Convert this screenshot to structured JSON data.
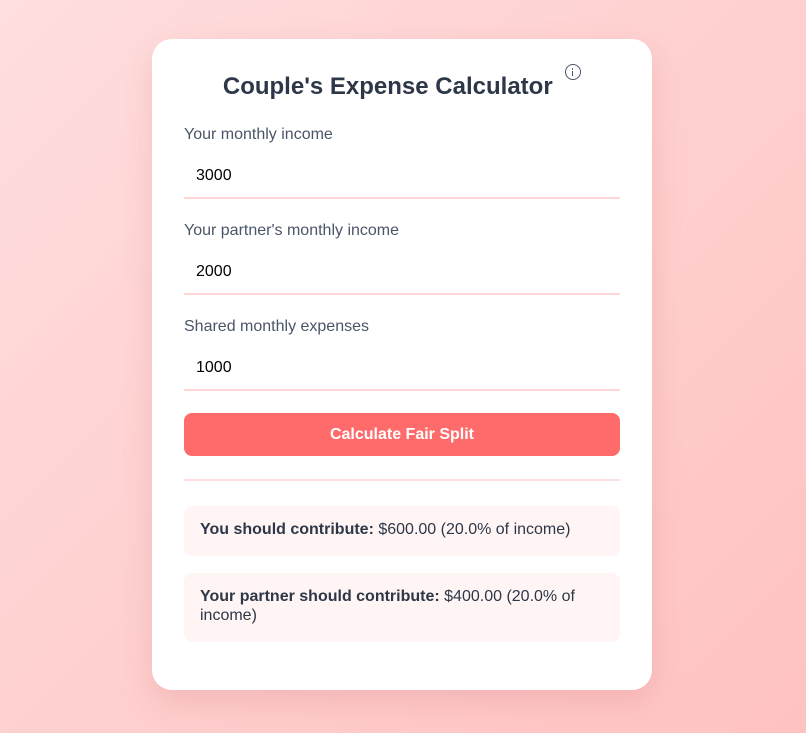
{
  "app": {
    "title": "Couple's Expense Calculator",
    "info_icon": "info-circle-icon"
  },
  "form": {
    "income": {
      "label": "Your monthly income",
      "value": "3000"
    },
    "partner_income": {
      "label": "Your partner's monthly income",
      "value": "2000"
    },
    "expenses": {
      "label": "Shared monthly expenses",
      "value": "1000"
    }
  },
  "actions": {
    "calculate_label": "Calculate Fair Split"
  },
  "results": {
    "you": {
      "label": "You should contribute:",
      "value": "$600.00 (20.0% of income)"
    },
    "partner": {
      "label": "Your partner should contribute:",
      "value": "$400.00 (20.0% of income)"
    }
  },
  "colors": {
    "accent": "#ff6b6b",
    "heading": "#2d3748",
    "label": "#4a5568",
    "input_border": "#ffd7d7",
    "result_bg": "#fff5f5",
    "background": "#ffd0d0"
  }
}
